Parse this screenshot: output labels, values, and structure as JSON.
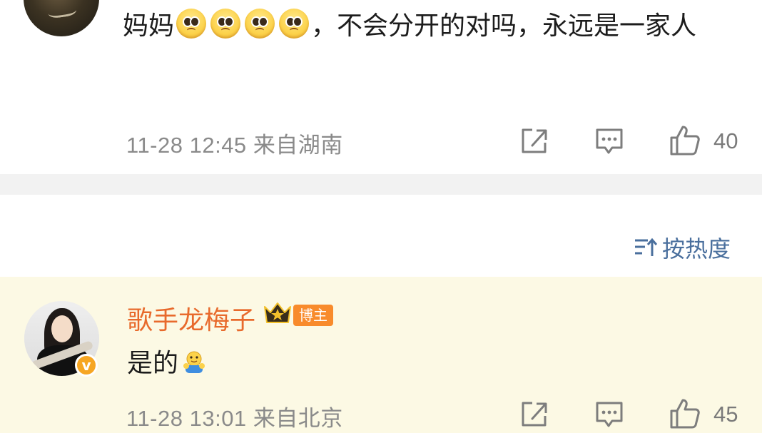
{
  "comments": [
    {
      "text_before": "妈妈",
      "emoji_name": "pleading-face-emoji",
      "emoji_count": 4,
      "text_after": "，不会分开的对吗，永远是一家人",
      "timestamp": "11-28 12:45",
      "location": "来自湖南",
      "like_count": "40"
    },
    {
      "username": "歌手龙梅子",
      "badge": "博主",
      "text": "是的",
      "emoji_name": "hug-emoji",
      "timestamp": "11-28 13:01",
      "location": "来自北京",
      "like_count": "45"
    }
  ],
  "sort": {
    "label": "按热度",
    "icon": "sort-icon"
  },
  "colors": {
    "username": "#e86a2c",
    "badge": "#f88b2c",
    "link": "#4a6f9d",
    "highlight_bg": "#fcf9e4",
    "meta": "#8a8a8a"
  },
  "icons": [
    "share-icon",
    "comment-icon",
    "like-icon",
    "crown-icon",
    "verified-icon"
  ]
}
